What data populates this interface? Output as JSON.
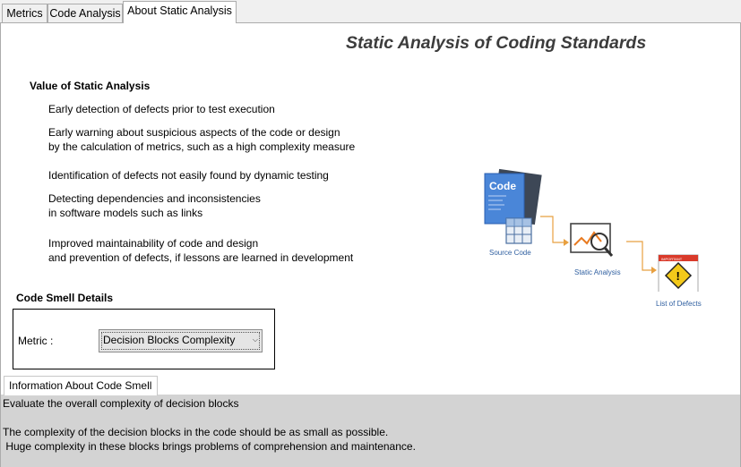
{
  "tabs": [
    {
      "label": "Metrics",
      "active": false
    },
    {
      "label": "Code Analysis",
      "active": false
    },
    {
      "label": "About Static Analysis",
      "active": true
    }
  ],
  "page_title": "Static Analysis of Coding Standards",
  "value_section": {
    "heading": "Value of Static Analysis",
    "points": [
      [
        "Early detection of defects prior to test execution"
      ],
      [
        "Early warning about suspicious aspects of the code or design",
        "by the calculation of metrics, such as a high complexity measure"
      ],
      [
        "Identification of defects not easily found by dynamic testing"
      ],
      [
        "Detecting dependencies and inconsistencies",
        "in software models such as links"
      ],
      [
        "Improved maintainability of code and design",
        "and prevention of defects, if lessons are learned in development"
      ]
    ]
  },
  "diagram": {
    "code_badge": "Code",
    "source_label": "Source Code",
    "analysis_label": "Static Analysis",
    "defects_label": "List of Defects",
    "important_tag": "IMPORTANT",
    "accent_color": "#e8a040",
    "blue_color": "#3a7bd5"
  },
  "smell_section": {
    "heading": "Code Smell Details",
    "metric_label": "Metric :",
    "metric_value": "Decision Blocks Complexity"
  },
  "info": {
    "tab_label": "Information About Code Smell",
    "lines": [
      "Evaluate the overall complexity of decision blocks",
      "",
      "The complexity of the decision blocks in the code should be as small as possible.",
      " Huge complexity in these blocks brings problems of comprehension and maintenance."
    ]
  }
}
